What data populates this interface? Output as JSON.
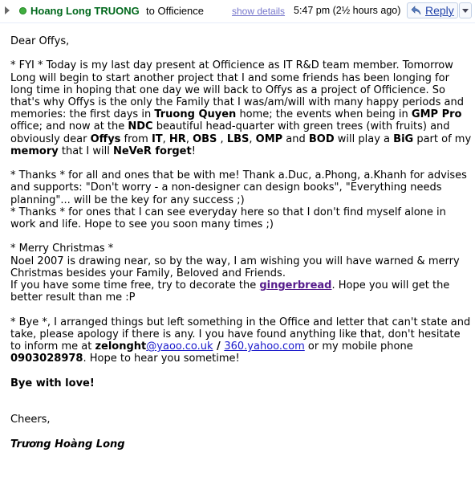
{
  "header": {
    "sender": "Hoang Long TRUONG",
    "to": "to Officience",
    "show_details": "show details",
    "timestamp": "5:47 pm (2½ hours ago)",
    "reply": "Reply",
    "icons": [
      "expand-arrow-icon",
      "online-status-icon",
      "reply-arrow-icon",
      "dropdown-arrow-icon"
    ],
    "colors": {
      "sender": "#00681c",
      "online": "#3fae3f",
      "link": "#1a1acc",
      "visited": "#551a8b"
    }
  },
  "email": {
    "greeting": "Dear Offys,",
    "p1": {
      "a": "* FYI * Today is my last day present at Officience as IT R&D team member. Tomorrow Long will begin to start another project that I and some friends has been longing for long time in hoping that one day we will back to Offys as a project of Officience. So that's why Offys is the only the Family that I was/am/will with many happy periods and memories: the first days in ",
      "truong_quyen": "Truong Quyen",
      "b": " home; the events when being in ",
      "gmp_pro": "GMP Pro",
      "c": " office; and now at the ",
      "ndc": "NDC",
      "d": " beautiful head-quarter with green trees (with fruits) and obviously dear ",
      "offys": "Offys",
      "e": " from ",
      "it": "IT",
      "f": ", ",
      "hr": "HR",
      "g": ", ",
      "obs": "OBS",
      "h": " , ",
      "lbs": "LBS",
      "i": ", ",
      "omp": "OMP",
      "j": " and ",
      "bod": "BOD",
      "k": " will play a ",
      "big": "BiG",
      "l": " part of my ",
      "memory": "memory",
      "m": " that I will ",
      "never_forget": "NeVeR forget",
      "n": "!"
    },
    "thanks1": "* Thanks * for all and ones that be with me! Thank a.Duc, a.Phong, a.Khanh for advises and supports: \"Don't worry - a non-designer can design books\", \"Everything needs planning\"... will be the key for any success ;)",
    "thanks2": "* Thanks * for ones that I can see everyday here so that I don't find myself alone in work and life. Hope to see you soon many times ;)",
    "xmas_title": "* Merry Christmas *",
    "xmas1": "Noel 2007 is drawing near, so by the way, I am wishing you will have warned & merry Christmas besides your Family, Beloved and Friends.",
    "xmas2a": "If you have some time free, try to decorate the ",
    "gingerbread": "gingerbread",
    "xmas2b": ". Hope you will get the better result than me :P",
    "bye_a": "* Bye *, I arranged things but left something in the Office and letter that can't state and take, please apology if there is any. I you have found anything like that, don't hesitate to inform me at ",
    "email_user": "zelonght",
    "email_domain": "@yaoo.co.uk",
    "slash": " / ",
    "yahoo_link": "360.yahoo.com",
    "bye_b": " or my mobile phone ",
    "phone": "0903028978",
    "bye_c": ". Hope to hear you sometime!",
    "bye_with_love": "Bye with love!",
    "cheers": "Cheers,",
    "signature": "Trương Hoàng Long"
  }
}
